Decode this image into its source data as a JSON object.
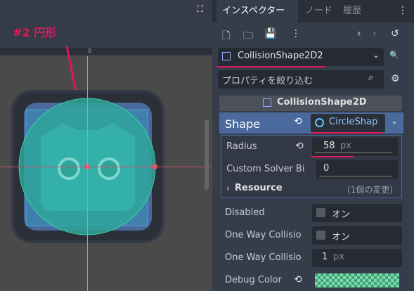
{
  "annotation": "#2 円形",
  "ruler_zero": "0",
  "tabs": [
    "インスペクター",
    "ノード",
    "履歴"
  ],
  "node_name": "CollisionShape2D2",
  "filter_placeholder": "プロパティを絞り込む",
  "section_title": "CollisionShape2D",
  "shape": {
    "label": "Shape",
    "value": "CircleShap"
  },
  "radius": {
    "label": "Radius",
    "value": "58",
    "unit": "px"
  },
  "custom_solver": {
    "label": "Custom Solver Bi",
    "value": "0"
  },
  "resource": {
    "label": "Resource",
    "changes": "(1個の変更)"
  },
  "disabled": {
    "label": "Disabled",
    "value": "オン"
  },
  "one_way": {
    "label": "One Way Collisio",
    "value": "オン"
  },
  "one_way_margin": {
    "label": "One Way Collisio",
    "value": "1",
    "unit": "px"
  },
  "debug_color": {
    "label": "Debug Color"
  },
  "colors": {
    "accent": "#e0165a",
    "circle": "#2fa59a",
    "select": "#4a6a9e"
  }
}
